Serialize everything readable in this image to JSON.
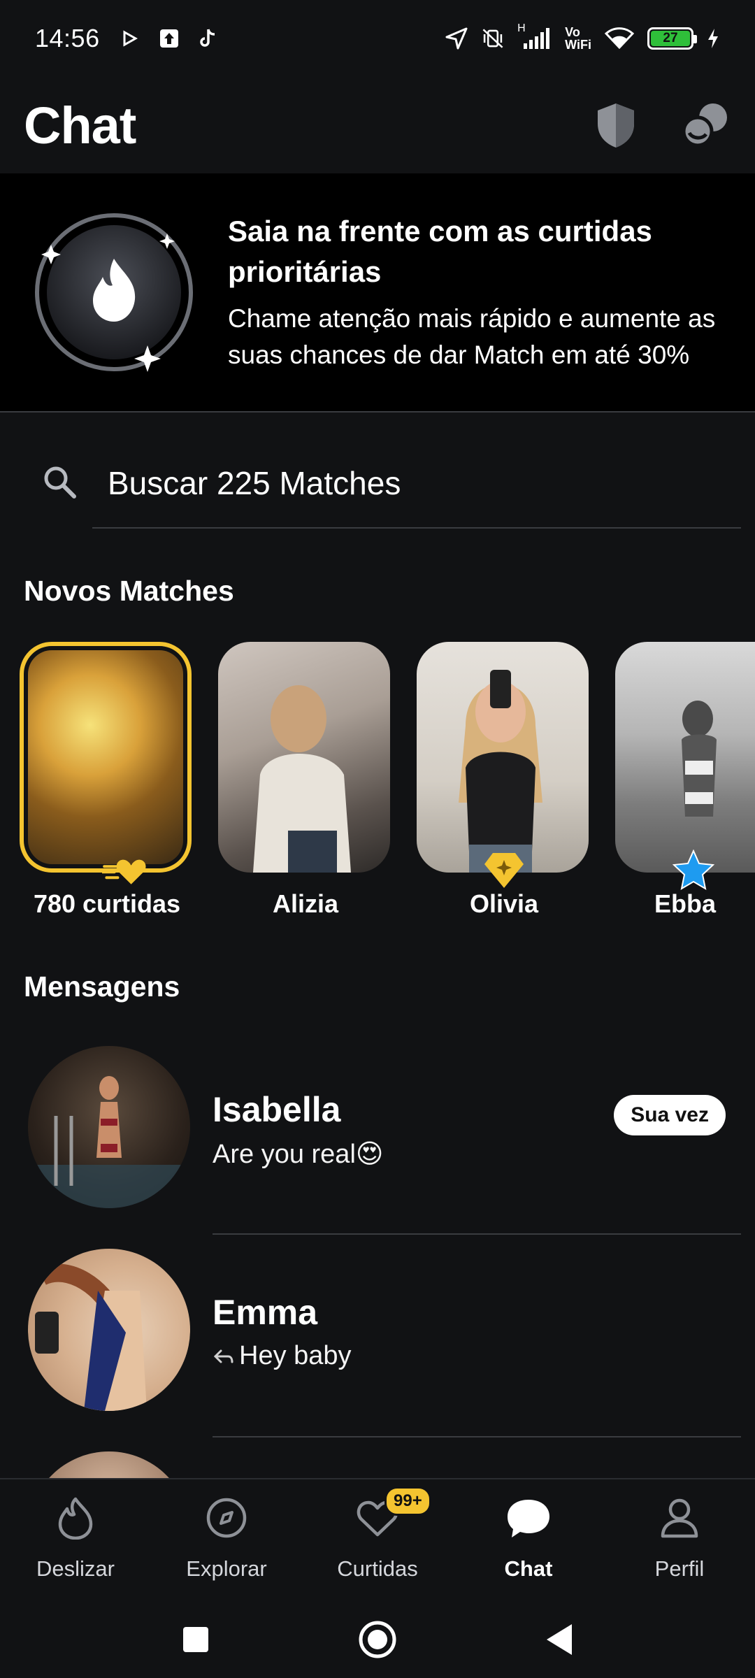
{
  "status_bar": {
    "time": "14:56",
    "network_type": "H",
    "volte_label": "Vo\nWiFi",
    "battery_level": "27"
  },
  "header": {
    "title": "Chat"
  },
  "promo": {
    "title": "Saia na frente com as curtidas prioritárias",
    "description": "Chame atenção mais rápido e aumente as suas chances de dar Match em até 30%"
  },
  "search": {
    "value": "Buscar 225 Matches"
  },
  "new_matches": {
    "title": "Novos Matches",
    "items": [
      {
        "name": "780 curtidas",
        "badge": "gold-heart"
      },
      {
        "name": "Alizia",
        "badge": ""
      },
      {
        "name": "Olivia",
        "badge": "gold-gem"
      },
      {
        "name": "Ebba",
        "badge": "blue-star"
      }
    ]
  },
  "messages": {
    "title": "Mensagens",
    "items": [
      {
        "name": "Isabella",
        "text": "Are you real😍",
        "badge": "Sua vez",
        "replied": false
      },
      {
        "name": "Emma",
        "text": "Hey baby",
        "badge": "",
        "replied": true
      }
    ]
  },
  "bottom_nav": {
    "items": [
      {
        "label": "Deslizar",
        "icon": "flame-icon"
      },
      {
        "label": "Explorar",
        "icon": "compass-icon"
      },
      {
        "label": "Curtidas",
        "icon": "heart-icon",
        "badge": "99+"
      },
      {
        "label": "Chat",
        "icon": "chat-bubble-icon",
        "active": true
      },
      {
        "label": "Perfil",
        "icon": "person-icon"
      }
    ]
  },
  "colors": {
    "background": "#111214",
    "gold": "#f4c430",
    "blue_star": "#1e9bf0",
    "divider": "#3a3c40"
  }
}
